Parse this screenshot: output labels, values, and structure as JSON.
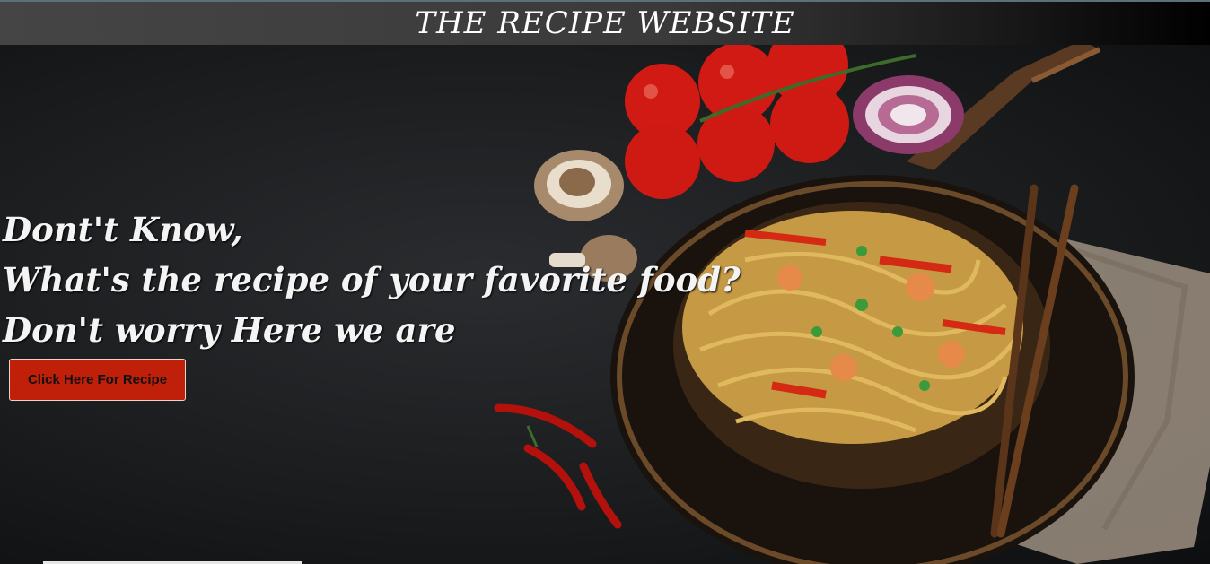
{
  "header": {
    "title": "THE RECIPE WEBSITE"
  },
  "hero": {
    "headline_lines": [
      "Dont't Know,",
      "What's the recipe of your favorite food?",
      "Don't worry Here we are"
    ],
    "cta_label": "Click Here For Recipe"
  },
  "colors": {
    "header_bg": "#404040",
    "cta_bg": "#c0200a",
    "hero_bg": "#1b1d1f"
  }
}
